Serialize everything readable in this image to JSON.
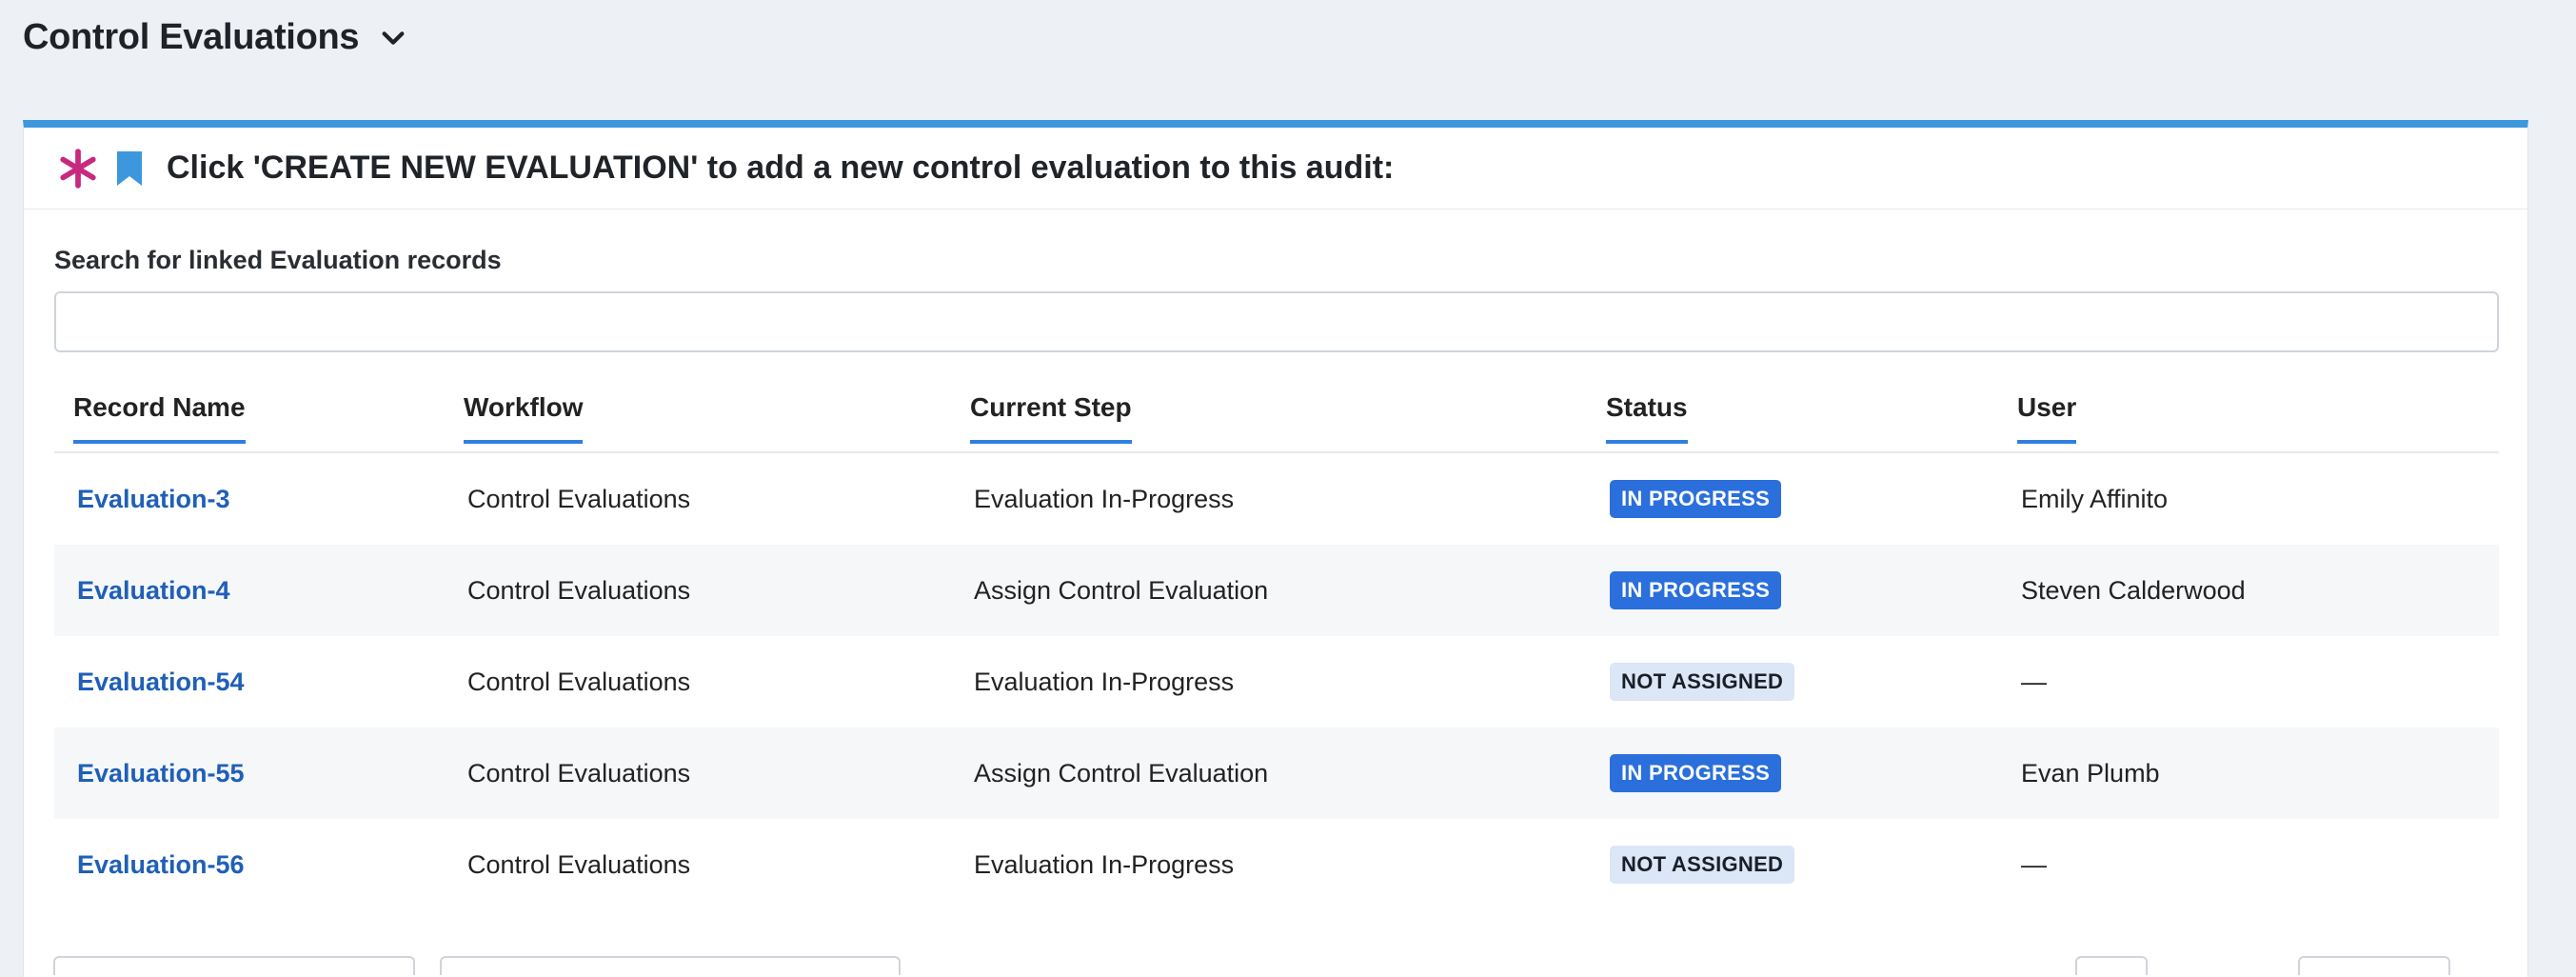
{
  "page": {
    "title": "Control Evaluations"
  },
  "card": {
    "heading": "Click 'CREATE NEW EVALUATION' to add a new control evaluation to this audit:",
    "accent_color": "#3d97dc",
    "asterisk_color": "#c8297f",
    "bookmark_color": "#3d97dc"
  },
  "search": {
    "label": "Search for linked Evaluation records",
    "value": "",
    "placeholder": ""
  },
  "table": {
    "columns": [
      "Record Name",
      "Workflow",
      "Current Step",
      "Status",
      "User"
    ],
    "rows": [
      {
        "record": "Evaluation-3",
        "workflow": "Control Evaluations",
        "step": "Evaluation In-Progress",
        "status": "IN PROGRESS",
        "user": "Emily Affinito"
      },
      {
        "record": "Evaluation-4",
        "workflow": "Control Evaluations",
        "step": "Assign Control Evaluation",
        "status": "IN PROGRESS",
        "user": "Steven Calderwood"
      },
      {
        "record": "Evaluation-54",
        "workflow": "Control Evaluations",
        "step": "Evaluation In-Progress",
        "status": "NOT ASSIGNED",
        "user": "—"
      },
      {
        "record": "Evaluation-55",
        "workflow": "Control Evaluations",
        "step": "Assign Control Evaluation",
        "status": "IN PROGRESS",
        "user": "Evan Plumb"
      },
      {
        "record": "Evaluation-56",
        "workflow": "Control Evaluations",
        "step": "Evaluation In-Progress",
        "status": "NOT ASSIGNED",
        "user": "—"
      }
    ]
  },
  "icons": {
    "title_toggle": "chevron-down-icon",
    "required": "asterisk-icon",
    "bookmark": "bookmark-icon"
  }
}
